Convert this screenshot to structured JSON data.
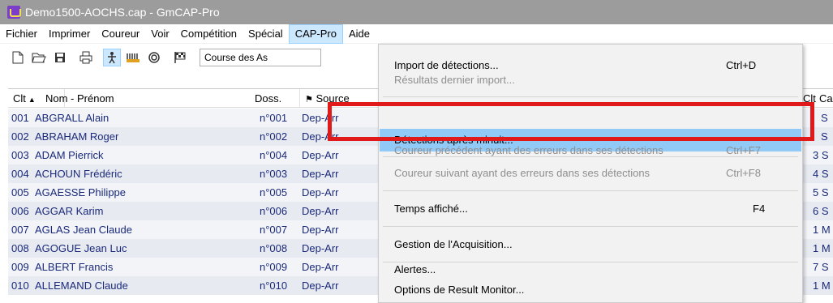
{
  "window": {
    "title": "Demo1500-AOCHS.cap - GmCAP-Pro"
  },
  "menubar": {
    "items": [
      "Fichier",
      "Imprimer",
      "Coureur",
      "Voir",
      "Compétition",
      "Spécial",
      "CAP-Pro",
      "Aide"
    ]
  },
  "toolbar": {
    "icons": [
      "new-file-icon",
      "open-folder-icon",
      "save-icon",
      "print-icon",
      "runner-icon",
      "chip-reader-icon",
      "antenna-icon",
      "checkered-flag-icon"
    ],
    "race_select": "Course des As"
  },
  "grid": {
    "headers": {
      "clt": "Clt",
      "name": "Nom - Prénom",
      "doss": "Doss.",
      "source": "Source",
      "right_a": "Clt",
      "right_b": "Ca"
    },
    "rows": [
      {
        "clt": "001",
        "name": "ABGRALL Alain",
        "doss": "n°001",
        "source": "Dep-Arr",
        "cat": "S"
      },
      {
        "clt": "002",
        "name": "ABRAHAM Roger",
        "doss": "n°002",
        "source": "Dep-Arr",
        "cat": "S"
      },
      {
        "clt": "003",
        "name": "ADAM Pierrick",
        "doss": "n°004",
        "source": "Dep-Arr",
        "cat": "3 S"
      },
      {
        "clt": "004",
        "name": "ACHOUN Frédéric",
        "doss": "n°003",
        "source": "Dep-Arr",
        "cat": "4 S"
      },
      {
        "clt": "005",
        "name": "AGAESSE Philippe",
        "doss": "n°005",
        "source": "Dep-Arr",
        "cat": "5 S"
      },
      {
        "clt": "006",
        "name": "AGGAR Karim",
        "doss": "n°006",
        "source": "Dep-Arr",
        "cat": "6 S"
      },
      {
        "clt": "007",
        "name": "AGLAS Jean Claude",
        "doss": "n°007",
        "source": "Dep-Arr",
        "cat": "1 M"
      },
      {
        "clt": "008",
        "name": "AGOGUE Jean Luc",
        "doss": "n°008",
        "source": "Dep-Arr",
        "cat": "1 M"
      },
      {
        "clt": "009",
        "name": "ALBERT Francis",
        "doss": "n°009",
        "source": "Dep-Arr",
        "cat": "7 S"
      },
      {
        "clt": "010",
        "name": "ALLEMAND Claude",
        "doss": "n°010",
        "source": "Dep-Arr",
        "cat": "1 M"
      }
    ]
  },
  "dropdown": {
    "items": [
      {
        "label": "Import de détections...",
        "shortcut": "Ctrl+D",
        "disabled": false
      },
      {
        "label": "Résultats dernier import...",
        "shortcut": "",
        "disabled": true
      },
      {
        "label": "Détections après minuit...",
        "shortcut": "",
        "disabled": false,
        "highlight": true
      },
      {
        "label": "Coureur précédent ayant des erreurs dans ses détections",
        "shortcut": "Ctrl+F7",
        "disabled": true
      },
      {
        "label": "Coureur suivant ayant des erreurs dans ses détections",
        "shortcut": "Ctrl+F8",
        "disabled": true
      },
      {
        "label": "Temps affiché...",
        "shortcut": "F4",
        "disabled": false
      },
      {
        "label": "Gestion de l'Acquisition...",
        "shortcut": "",
        "disabled": false
      },
      {
        "label": "Alertes...",
        "shortcut": "",
        "disabled": false
      },
      {
        "label": "Options de Result Monitor...",
        "shortcut": "",
        "disabled": false
      }
    ]
  },
  "colors": {
    "highlight": "#91c9f7",
    "annotation": "#e0191b",
    "row_text": "#1a2a7a"
  }
}
